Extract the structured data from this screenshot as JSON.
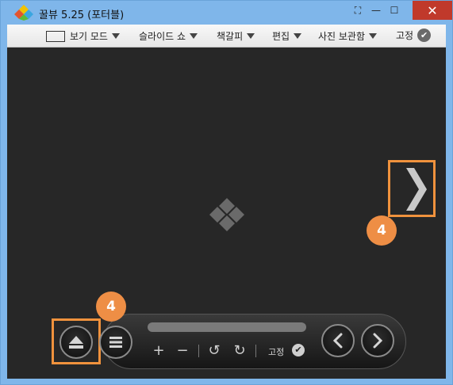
{
  "window": {
    "title": "꿀뷰 5.25 (포터블)",
    "controls": {
      "fullscreen": "⛶",
      "minimize": "—",
      "maximize": "☐",
      "close": "✕"
    }
  },
  "menu": {
    "items": [
      {
        "label": "보기 모드",
        "icon": "frame-icon"
      },
      {
        "label": "슬라이드 쇼"
      },
      {
        "label": "책갈피"
      },
      {
        "label": "편집"
      },
      {
        "label": "사진 보관함"
      }
    ],
    "pin_label": "고정",
    "pin_check": "✔"
  },
  "annotations": {
    "badge_next": "4",
    "badge_eject": "4",
    "accent": "#f0923d"
  },
  "controlbar": {
    "zoom_in": "+",
    "zoom_out": "−",
    "rotate_left": "↺",
    "rotate_right": "↻",
    "pin_label": "고정",
    "pin_check": "✔",
    "prev": "‹",
    "next": "›"
  }
}
